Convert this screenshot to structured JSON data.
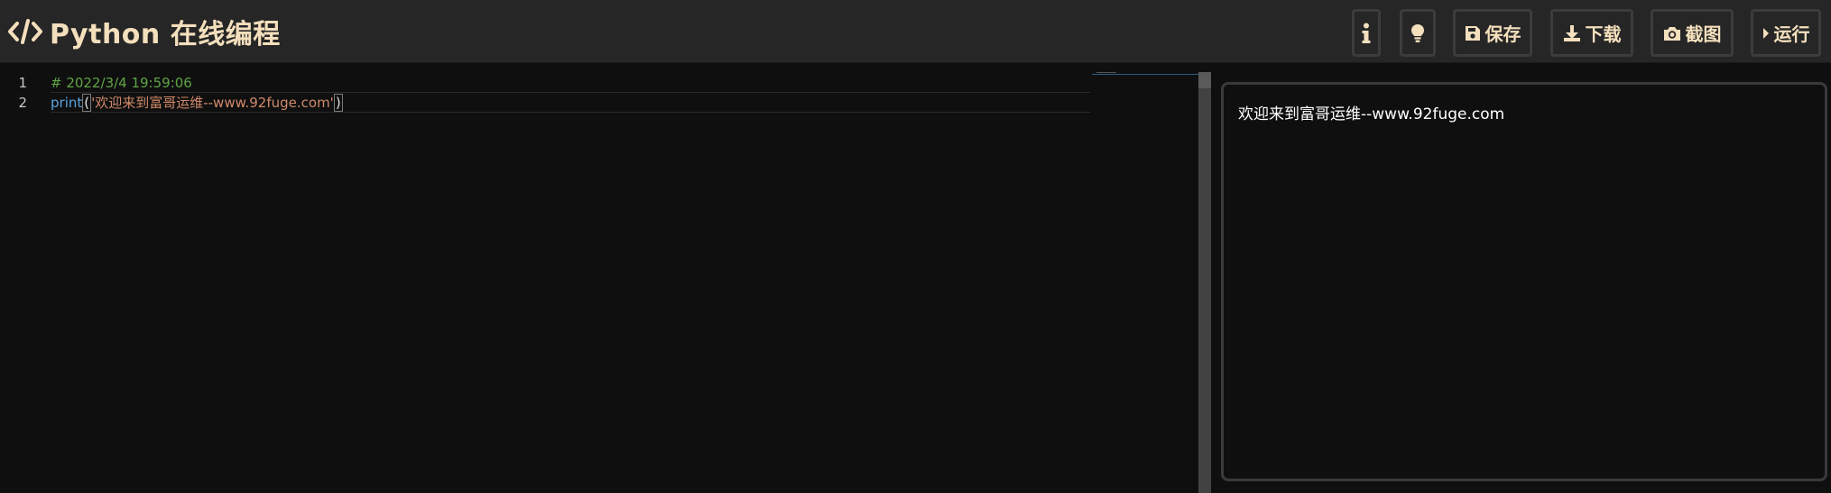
{
  "header": {
    "title": "Python 在线编程",
    "buttons": {
      "info": {
        "icon": "info-icon"
      },
      "hint": {
        "icon": "lightbulb-icon"
      },
      "save": {
        "icon": "floppy-disk-icon",
        "label": "保存"
      },
      "download": {
        "icon": "download-icon",
        "label": "下载"
      },
      "screenshot": {
        "icon": "camera-icon",
        "label": "截图"
      },
      "run": {
        "icon": "play-triangle-icon",
        "label": "运行"
      }
    }
  },
  "editor": {
    "lines": [
      {
        "number": "1",
        "comment": "# 2022/3/4 19:59:06"
      },
      {
        "number": "2",
        "keyword": "print",
        "open_paren": "(",
        "string": "'欢迎来到富哥运维--www.92fuge.com'",
        "close_paren": ")"
      }
    ]
  },
  "output": {
    "text": "欢迎来到富哥运维--www.92fuge.com"
  },
  "colors": {
    "accent": "#f4dfbd",
    "comment": "#5fa345",
    "keyword": "#5aa4e0",
    "string": "#d0896a"
  }
}
